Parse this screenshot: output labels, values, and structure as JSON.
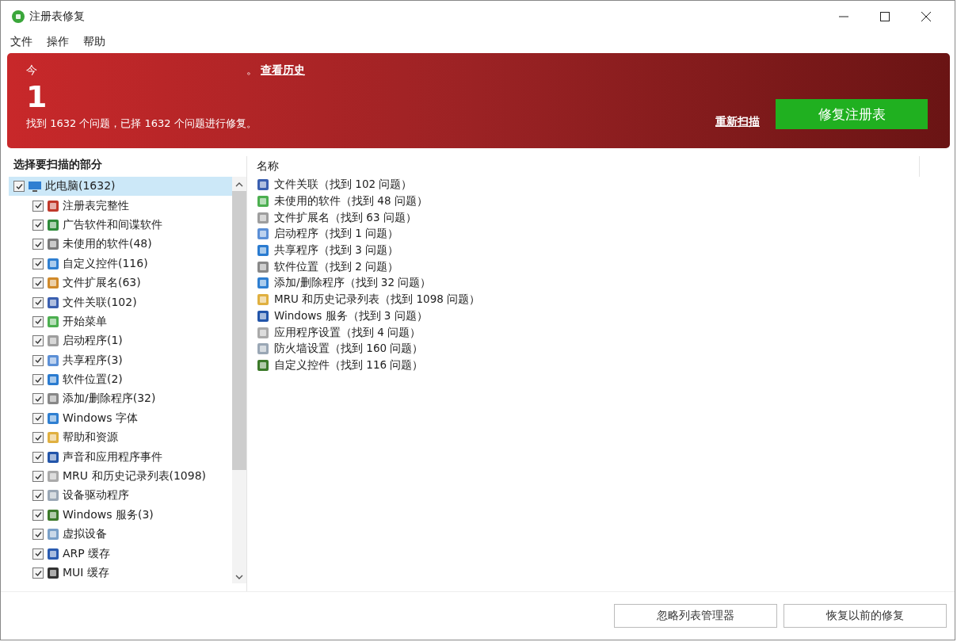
{
  "window": {
    "title": "注册表修复"
  },
  "menu": [
    "文件",
    "操作",
    "帮助"
  ],
  "banner": {
    "heading_start": "今",
    "heading_end": "。",
    "history_link": "查看历史",
    "big_number": "1",
    "summary": "找到 1632 个问题，已择 1632 个问题进行修复。",
    "rescan_link": "重新扫描",
    "fix_button": "修复注册表"
  },
  "sections": {
    "title": "选择要扫描的部分",
    "tree": [
      {
        "label": "此电脑(1632)",
        "checked": true,
        "selected": true,
        "children": [
          {
            "label": "注册表完整性",
            "checked": true,
            "selected": false
          },
          {
            "label": "广告软件和间谍软件",
            "checked": true,
            "selected": false
          },
          {
            "label": "未使用的软件(48)",
            "checked": true,
            "selected": false
          },
          {
            "label": "自定义控件(116)",
            "checked": true,
            "selected": false
          },
          {
            "label": "文件扩展名(63)",
            "checked": true,
            "selected": false
          },
          {
            "label": "文件关联(102)",
            "checked": true,
            "selected": false
          },
          {
            "label": "开始菜单",
            "checked": true,
            "selected": false
          },
          {
            "label": "启动程序(1)",
            "checked": true,
            "selected": false
          },
          {
            "label": "共享程序(3)",
            "checked": true,
            "selected": false
          },
          {
            "label": "软件位置(2)",
            "checked": true,
            "selected": false
          },
          {
            "label": "添加/删除程序(32)",
            "checked": true,
            "selected": false
          },
          {
            "label": "Windows 字体",
            "checked": true,
            "selected": false
          },
          {
            "label": "帮助和资源",
            "checked": true,
            "selected": false
          },
          {
            "label": "声音和应用程序事件",
            "checked": true,
            "selected": false
          },
          {
            "label": "MRU 和历史记录列表(1098)",
            "checked": true,
            "selected": false
          },
          {
            "label": "设备驱动程序",
            "checked": true,
            "selected": false
          },
          {
            "label": "Windows 服务(3)",
            "checked": true,
            "selected": false
          },
          {
            "label": "虚拟设备",
            "checked": true,
            "selected": false
          },
          {
            "label": "ARP 缓存",
            "checked": true,
            "selected": false
          },
          {
            "label": "MUI 缓存",
            "checked": true,
            "selected": false
          }
        ]
      }
    ]
  },
  "results": {
    "column": "名称",
    "rows": [
      "文件关联（找到 102 问题）",
      "未使用的软件（找到 48 问题）",
      "文件扩展名（找到 63 问题）",
      "启动程序（找到 1 问题）",
      "共享程序（找到 3 问题）",
      "软件位置（找到 2 问题）",
      "添加/删除程序（找到 32 问题）",
      "MRU 和历史记录列表（找到 1098 问题）",
      "Windows 服务（找到 3 问题）",
      "应用程序设置（找到 4 问题）",
      "防火墙设置（找到 160 问题）",
      "自定义控件（找到 116 问题）"
    ]
  },
  "buttons": [
    "忽略列表管理器",
    "恢复以前的修复"
  ]
}
